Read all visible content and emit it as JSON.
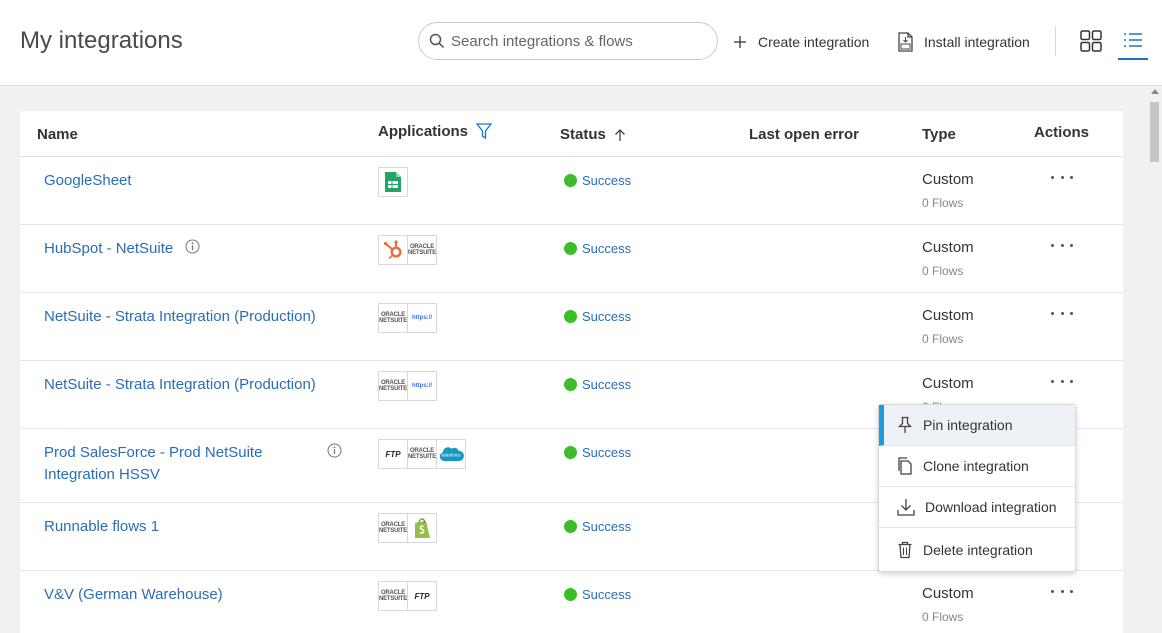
{
  "header": {
    "title": "My integrations",
    "search_placeholder": "Search integrations & flows",
    "create_label": "Create integration",
    "install_label": "Install integration"
  },
  "table": {
    "columns": {
      "name": "Name",
      "applications": "Applications",
      "status": "Status",
      "last_error": "Last open error",
      "type": "Type",
      "actions": "Actions"
    },
    "rows": [
      {
        "name_line1": "GoogleSheet",
        "name_line2": "",
        "info": false,
        "apps": [
          "google-sheets"
        ],
        "status": "Success",
        "type": "Custom",
        "flows": "0 Flows"
      },
      {
        "name_line1": "HubSpot - NetSuite",
        "name_line2": "",
        "info": true,
        "apps": [
          "hubspot",
          "oracle-netsuite"
        ],
        "status": "Success",
        "type": "Custom",
        "flows": "0 Flows"
      },
      {
        "name_line1": "NetSuite - Strata Integration (Production)",
        "name_line2": "",
        "info": false,
        "apps": [
          "oracle-netsuite",
          "https"
        ],
        "status": "Success",
        "type": "Custom",
        "flows": "0 Flows"
      },
      {
        "name_line1": "NetSuite - Strata Integration (Production)",
        "name_line2": "",
        "info": false,
        "apps": [
          "oracle-netsuite",
          "https"
        ],
        "status": "Success",
        "type": "Custom",
        "flows": "0 Flows"
      },
      {
        "name_line1": "Prod SalesForce - Prod NetSuite",
        "name_line2": "Integration HSSV",
        "info": true,
        "apps": [
          "ftp",
          "oracle-netsuite",
          "salesforce"
        ],
        "status": "Success",
        "type": "",
        "flows": ""
      },
      {
        "name_line1": "Runnable flows 1",
        "name_line2": "",
        "info": false,
        "apps": [
          "oracle-netsuite",
          "shopify"
        ],
        "status": "Success",
        "type": "",
        "flows": ""
      },
      {
        "name_line1": "V&V (German Warehouse)",
        "name_line2": "",
        "info": false,
        "apps": [
          "oracle-netsuite",
          "ftp"
        ],
        "status": "Success",
        "type": "Custom",
        "flows": "0 Flows"
      }
    ]
  },
  "app_logos": {
    "oracle_line1": "ORACLE",
    "oracle_line2": "NETSUITE",
    "ftp": "FTP",
    "https": "https://",
    "salesforce": "salesforce"
  },
  "context_menu": {
    "items": [
      {
        "label": "Pin integration",
        "icon": "pin-icon"
      },
      {
        "label": "Clone integration",
        "icon": "clone-icon"
      },
      {
        "label": "Download integration",
        "icon": "download-icon"
      },
      {
        "label": "Delete integration",
        "icon": "trash-icon"
      }
    ]
  },
  "colors": {
    "link": "#2a6db5",
    "success": "#3ebd2b",
    "accent": "#1a73c9",
    "menu_active": "#1a9be0"
  }
}
